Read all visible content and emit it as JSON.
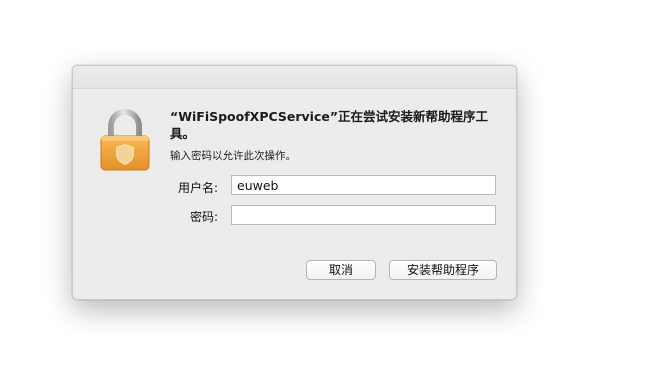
{
  "dialog": {
    "title": "“WiFiSpoofXPCService”正在尝试安装新帮助程序工具。",
    "subtitle": "输入密码以允许此次操作。",
    "icon": "padlock-icon"
  },
  "form": {
    "username_label": "用户名:",
    "username_value": "euweb",
    "password_label": "密码:",
    "password_value": ""
  },
  "buttons": {
    "cancel_label": "取消",
    "install_label": "安装帮助程序"
  },
  "colors": {
    "lock_body": "#f2a93b",
    "lock_shackle": "#c4c4c4",
    "dialog_bg": "#ececec"
  }
}
